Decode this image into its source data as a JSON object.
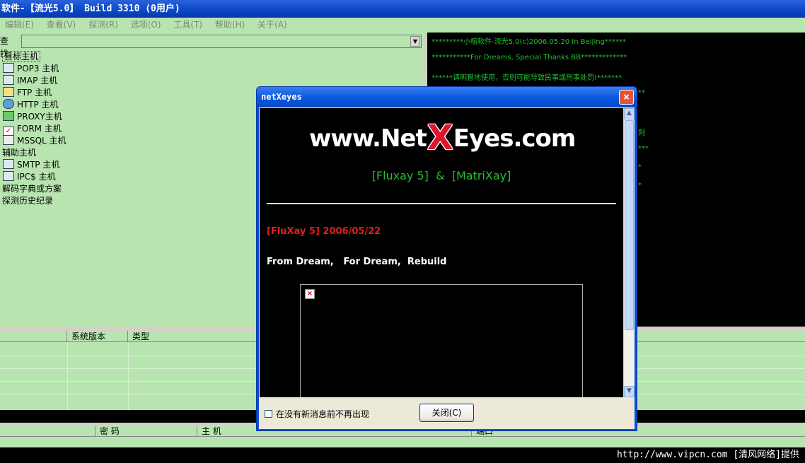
{
  "window": {
    "title": "软件-【流光5.0】 Build 3310 (0用户)"
  },
  "menu": [
    "编辑(E)",
    "查看(V)",
    "探测(R)",
    "选项(O)",
    "工具(T)",
    "帮助(H)",
    "关于(A)"
  ],
  "find": {
    "label": "查找:",
    "value": ""
  },
  "tree": {
    "root": "目标主机",
    "children": [
      "POP3 主机",
      "IMAP 主机",
      "FTP  主机",
      "HTTP 主机",
      "PROXY主机",
      "FORM 主机",
      "MSSQL 主机"
    ],
    "aux": "辅助主机",
    "aux_children": [
      "SMTP 主机",
      "IPC$ 主机"
    ],
    "dict": "解码字典或方案",
    "history": "探测历史纪录"
  },
  "console": [
    "*********小榕软件-流光5.0(c)2006.05.20 In BeiJing******",
    "***********For Dreams, Special Thanks BB*************",
    "******请明智地使用，否则可能导致民事或刑事处罚!*******",
    "**",
    "刻",
    "***",
    "*",
    "*"
  ],
  "grid1": {
    "headers": [
      "",
      "系统版本",
      "类型"
    ]
  },
  "grid2": {
    "headers": [
      "",
      "密 码",
      "主 机",
      "端口"
    ]
  },
  "status": "http://www.vipcn.com [清风网络]提供",
  "dialog": {
    "title": "netXeyes",
    "logo_left": "www.Net",
    "logo_x": "X",
    "logo_right": "Eyes.com",
    "products": "[Fluxay 5]  &  [MatriXay]",
    "version_line": "[FluXay 5] 2006/05/22",
    "motto": "From Dream,   For Dream,  Rebuild",
    "checkbox_label": "在没有新消息前不再出现",
    "close_label": "关闭(C)",
    "close_glyph": "×"
  },
  "colors": {
    "pane_green": "#b8e4b0",
    "console_text": "#22c032",
    "dialog_blue": "#0b4fd8",
    "version_red": "#e02020"
  }
}
